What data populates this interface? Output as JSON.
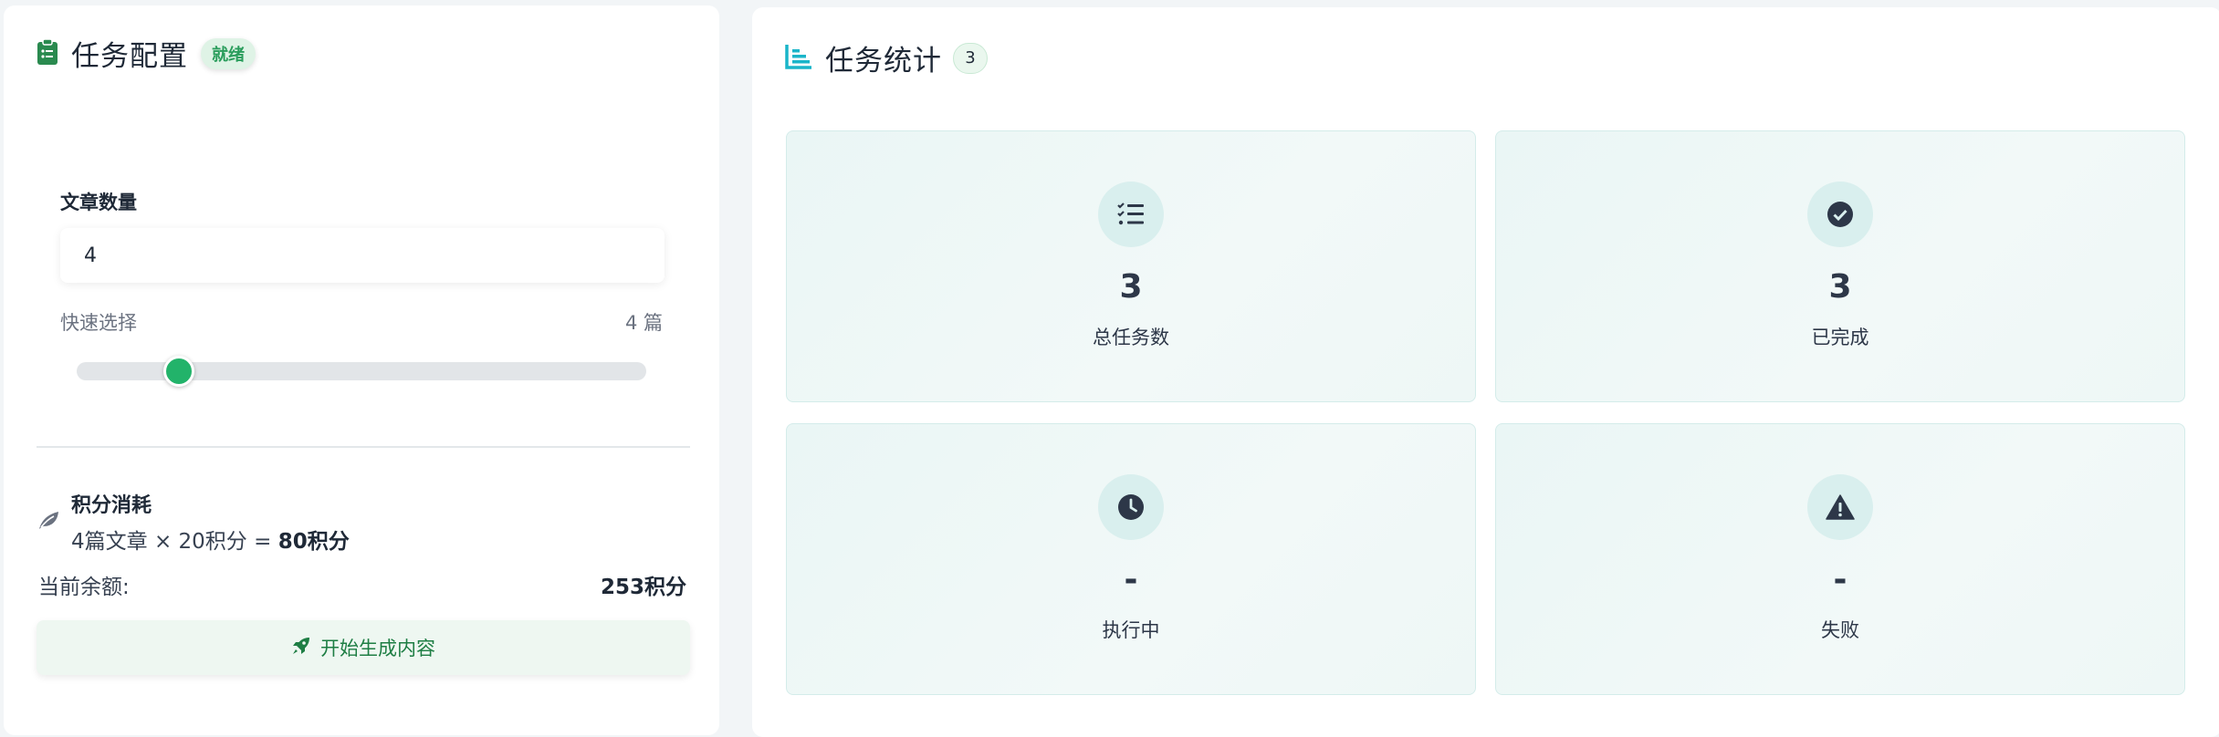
{
  "config_panel": {
    "title": "任务配置",
    "status_badge": "就绪",
    "article_count_label": "文章数量",
    "article_count_value": "4",
    "quick_select_label": "快速选择",
    "quick_select_value": "4 篇",
    "slider_fraction": 0.18,
    "cost_title": "积分消耗",
    "cost_formula_prefix": "4篇文章 × 20积分 = ",
    "cost_formula_total": "80积分",
    "balance_label": "当前余额:",
    "balance_value": "253积分",
    "start_button": "开始生成内容"
  },
  "stats_panel": {
    "title": "任务统计",
    "count_badge": "3",
    "cards": [
      {
        "icon": "list-check-icon",
        "value": "3",
        "label": "总任务数"
      },
      {
        "icon": "check-circle-icon",
        "value": "3",
        "label": "已完成"
      },
      {
        "icon": "clock-icon",
        "value": "-",
        "label": "执行中"
      },
      {
        "icon": "warning-icon",
        "value": "-",
        "label": "失败"
      }
    ]
  },
  "colors": {
    "accent_green": "#22b36a",
    "stats_icon_cyan": "#1ab5c9",
    "clipboard_green": "#2a8a4f"
  }
}
